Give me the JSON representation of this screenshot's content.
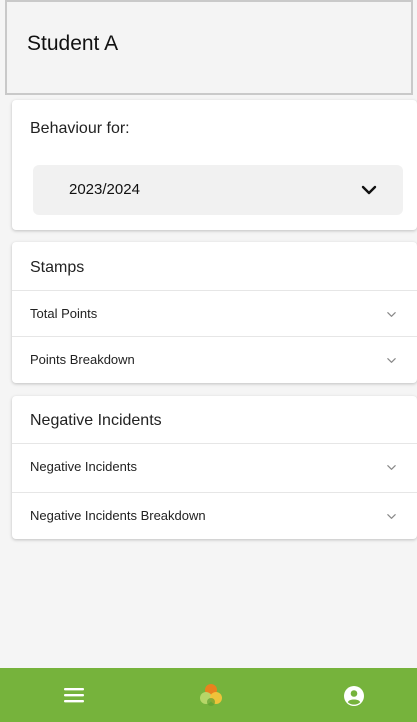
{
  "header": {
    "title": "Student A"
  },
  "behaviour": {
    "label": "Behaviour for:",
    "selected_year": "2023/2024"
  },
  "stamps": {
    "title": "Stamps",
    "rows": [
      {
        "label": "Total Points"
      },
      {
        "label": "Points Breakdown"
      }
    ]
  },
  "negative": {
    "title": "Negative Incidents",
    "rows": [
      {
        "label": "Negative Incidents"
      },
      {
        "label": "Negative Incidents Breakdown"
      }
    ]
  },
  "bottom_nav": {
    "bar_color": "#76b33c",
    "icons": [
      "menu-icon",
      "app-logo-icon",
      "user-account-icon"
    ]
  }
}
